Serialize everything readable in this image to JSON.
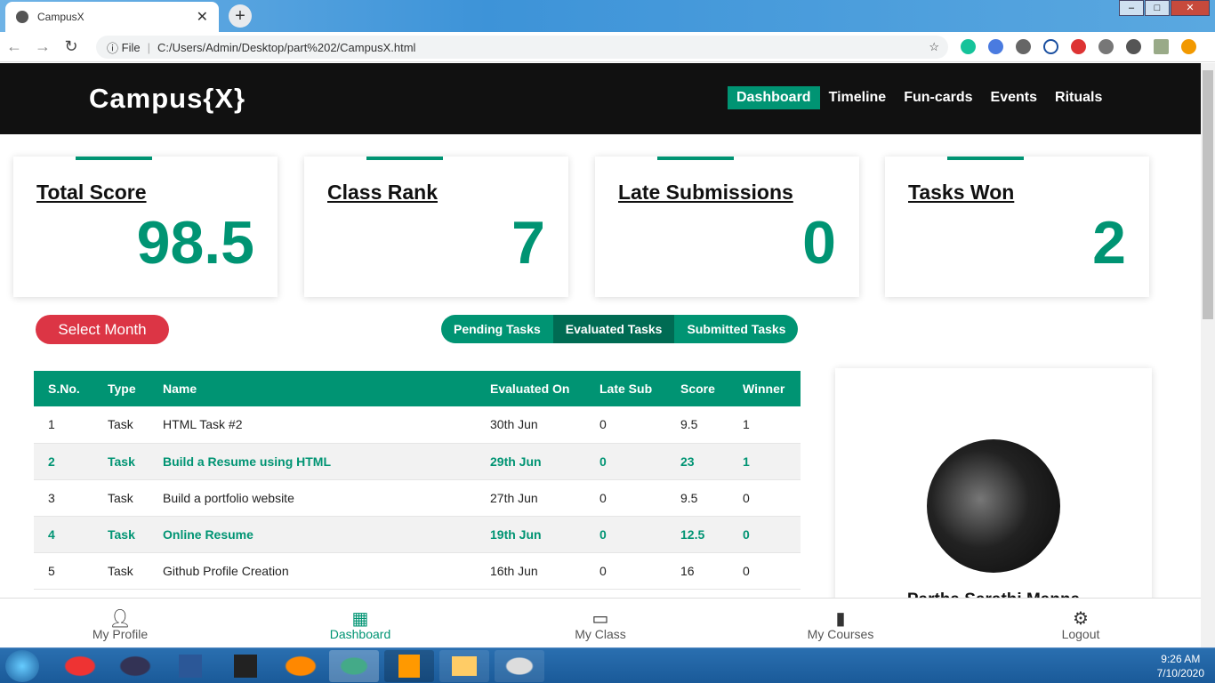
{
  "browser": {
    "tab_title": "CampusX",
    "url_prefix": "File",
    "url": "C:/Users/Admin/Desktop/part%202/CampusX.html"
  },
  "header": {
    "logo": "Campus{X}",
    "menu": [
      "Dashboard",
      "Timeline",
      "Fun-cards",
      "Events",
      "Rituals"
    ]
  },
  "stats": [
    {
      "title": "Total Score",
      "value": "98.5"
    },
    {
      "title": "Class Rank",
      "value": "7"
    },
    {
      "title": "Late Submissions",
      "value": "0"
    },
    {
      "title": "Tasks Won",
      "value": "2"
    }
  ],
  "controls": {
    "select_month": "Select Month",
    "tabs": [
      "Pending Tasks",
      "Evaluated Tasks",
      "Submitted Tasks"
    ]
  },
  "table": {
    "headers": [
      "S.No.",
      "Type",
      "Name",
      "Evaluated On",
      "Late Sub",
      "Score",
      "Winner"
    ],
    "rows": [
      [
        "1",
        "Task",
        "HTML Task #2",
        "30th Jun",
        "0",
        "9.5",
        "1"
      ],
      [
        "2",
        "Task",
        "Build a Resume using HTML",
        "29th Jun",
        "0",
        "23",
        "1"
      ],
      [
        "3",
        "Task",
        "Build a portfolio website",
        "27th Jun",
        "0",
        "9.5",
        "0"
      ],
      [
        "4",
        "Task",
        "Online Resume",
        "19th Jun",
        "0",
        "12.5",
        "0"
      ],
      [
        "5",
        "Task",
        "Github Profile Creation",
        "16th Jun",
        "0",
        "16",
        "0"
      ]
    ]
  },
  "profile": {
    "name": "Partha Sarathi Manna"
  },
  "bottom_nav": [
    "My Profile",
    "Dashboard",
    "My Class",
    "My Courses",
    "Logout"
  ],
  "taskbar": {
    "time": "9:26 AM",
    "date": "7/10/2020"
  },
  "colors": {
    "accent": "#009473",
    "danger": "#dc3545"
  }
}
